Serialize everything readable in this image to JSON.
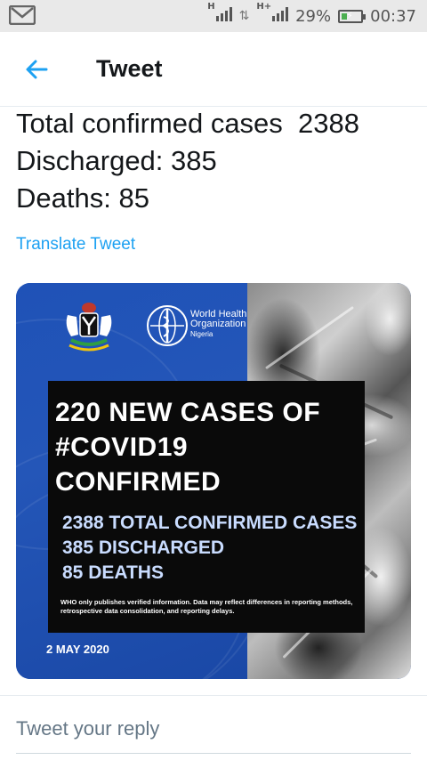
{
  "status_bar": {
    "net_label_1": "H",
    "net_label_2": "H+",
    "battery_percent": "29%",
    "battery_level": 0.29,
    "time": "00:37"
  },
  "header": {
    "title": "Tweet"
  },
  "tweet": {
    "lines": [
      "Total confirmed cases  2388",
      "Discharged: 385",
      "Deaths: 85"
    ],
    "translate_label": "Translate Tweet"
  },
  "media": {
    "who_name_line1": "World Health",
    "who_name_line2": "Organization",
    "who_country": "Nigeria",
    "headline_lines": [
      "220 NEW CASES OF",
      "#COVID19",
      "CONFIRMED"
    ],
    "stat_lines": [
      "2388 TOTAL CONFIRMED CASES",
      "385 DISCHARGED",
      "85 DEATHS"
    ],
    "disclaimer": "WHO only publishes verified information. Data may reflect differences in reporting methods, retrospective data consolidation, and reporting delays.",
    "date": "2 MAY 2020"
  },
  "reply": {
    "placeholder": "Tweet your reply"
  },
  "colors": {
    "accent": "#1da1f2",
    "media_blue": "#1e4fb0"
  },
  "icons": [
    "gmail-icon",
    "signal-icon",
    "data-arrows-icon",
    "battery-icon",
    "back-arrow-icon",
    "coat-of-arms-icon",
    "who-emblem-icon"
  ]
}
